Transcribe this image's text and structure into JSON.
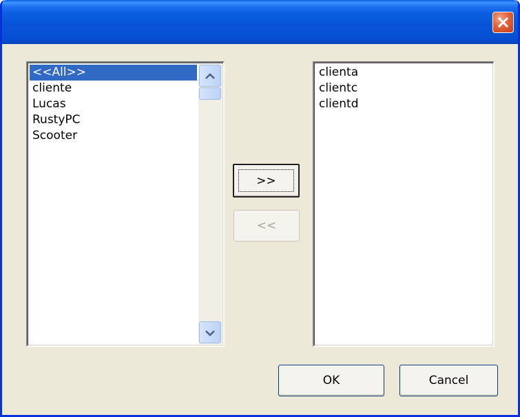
{
  "window": {
    "title": ""
  },
  "left_list": {
    "items": [
      "<<All>>",
      "cliente",
      "Lucas",
      "RustyPC",
      "Scooter"
    ],
    "selected_index": 0
  },
  "right_list": {
    "items": [
      "clienta",
      "clientc",
      "clientd"
    ]
  },
  "buttons": {
    "add_label": ">>",
    "remove_label": "<<",
    "ok_label": "OK",
    "cancel_label": "Cancel"
  },
  "icons": {
    "close": "close-icon",
    "scroll_up": "scroll-up-arrow-icon",
    "scroll_down": "scroll-down-arrow-icon"
  },
  "colors": {
    "titlebar": "#0a5ee0",
    "selection": "#316ac5",
    "close_button": "#e2613a",
    "dialog_background": "#ece9d8"
  }
}
